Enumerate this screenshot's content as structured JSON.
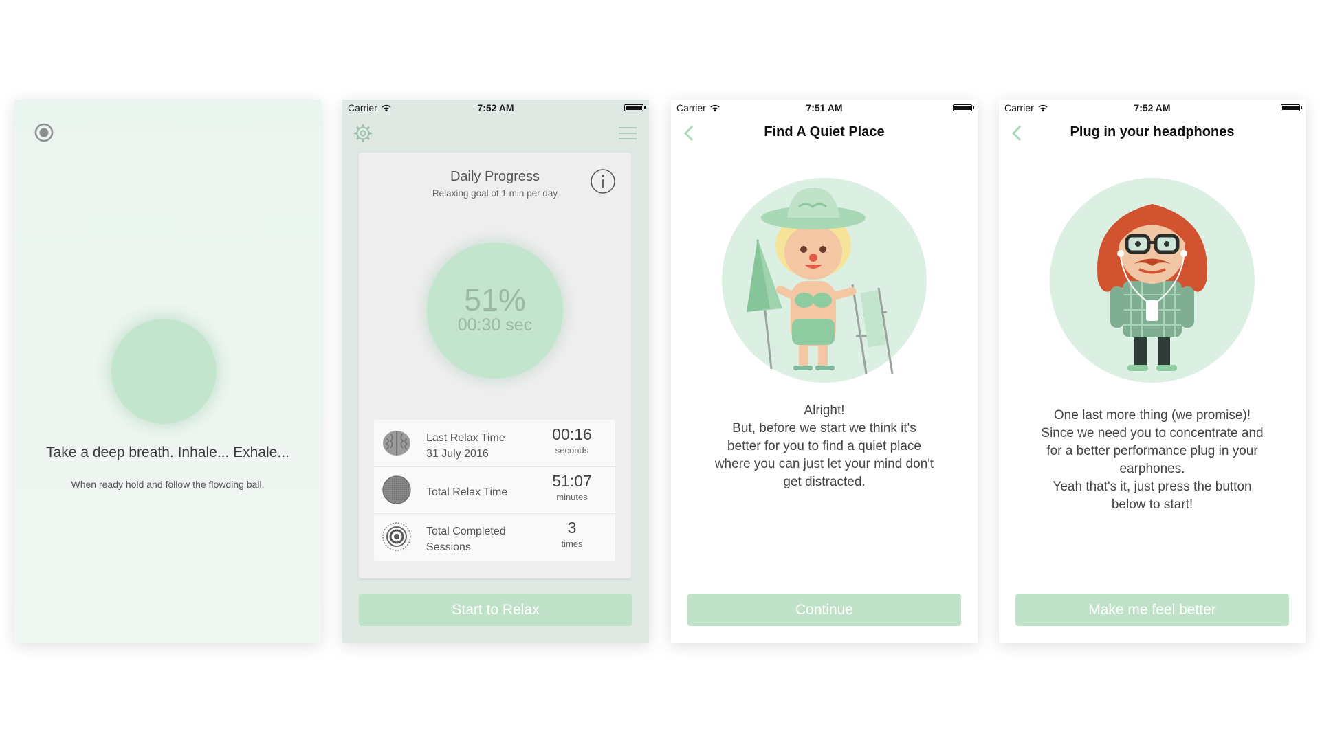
{
  "screen1": {
    "main_text": "Take a deep breath. Inhale... Exhale...",
    "sub_text": "When ready hold and follow the flowding ball.",
    "icons": {
      "top_left": "target-icon"
    }
  },
  "screen2": {
    "status": {
      "carrier": "Carrier",
      "time": "7:52 AM"
    },
    "icons": {
      "settings": "gear-icon",
      "menu": "hamburger-icon",
      "info": "info-icon"
    },
    "card": {
      "title": "Daily Progress",
      "subtitle": "Relaxing goal of 1 min per day",
      "progress_percent": "51%",
      "progress_time": "00:30 sec",
      "progress_fraction": 0.51
    },
    "stats": [
      {
        "label_line1": "Last Relax Time",
        "label_line2": "31 July 2016",
        "value": "00:16",
        "unit": "seconds",
        "icon": "brain-icon"
      },
      {
        "label_line1": "Total Relax Time",
        "label_line2": "",
        "value": "51:07",
        "unit": "minutes",
        "icon": "textured-circle-icon"
      },
      {
        "label_line1": "Total Completed",
        "label_line2": "Sessions",
        "value": "3",
        "unit": "times",
        "icon": "target-icon"
      }
    ],
    "button": "Start to Relax"
  },
  "screen3": {
    "status": {
      "carrier": "Carrier",
      "time": "7:51 AM"
    },
    "title": "Find A Quiet Place",
    "paragraph": [
      "Alright!",
      "But, before we start we think it's",
      "better for you to find a quiet place",
      "where you can just let your mind don't",
      "get distracted."
    ],
    "button": "Continue",
    "icons": {
      "back": "chevron-left-icon",
      "illustration": "beach-girl-illustration"
    }
  },
  "screen4": {
    "status": {
      "carrier": "Carrier",
      "time": "7:52 AM"
    },
    "title": "Plug in your headphones",
    "paragraph": [
      "One last more thing (we promise)!",
      "Since we need you to concentrate and",
      "for a better performance plug in your",
      "earphones.",
      "Yeah that's it, just press the button",
      "below to start!"
    ],
    "button": "Make me feel better",
    "icons": {
      "back": "chevron-left-icon",
      "illustration": "hipster-headphones-illustration"
    }
  },
  "colors": {
    "accent_green": "#bfe2c9",
    "ball_green": "#c3e5cd",
    "illustration_bg": "#dcefe3",
    "back_chevron": "#a9d8b6"
  }
}
